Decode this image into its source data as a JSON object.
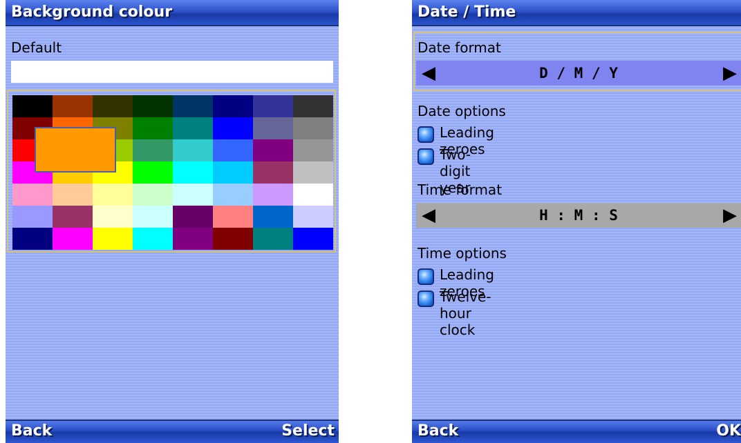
{
  "left_screen": {
    "title": "Background colour",
    "colour_label": "Default",
    "colour_field_value": "",
    "palette": [
      [
        "#000000",
        "#993300",
        "#333300",
        "#003300",
        "#003366",
        "#000080",
        "#333399",
        "#333333"
      ],
      [
        "#800000",
        "#ff6600",
        "#808000",
        "#008000",
        "#008080",
        "#0000ff",
        "#666699",
        "#808080"
      ],
      [
        "#ff0000",
        "#ff9900",
        "#99cc00",
        "#339966",
        "#33cccc",
        "#3366ff",
        "#800080",
        "#969696"
      ],
      [
        "#ff00ff",
        "#ffcc00",
        "#ffff00",
        "#00ff00",
        "#00ffff",
        "#00ccff",
        "#993366",
        "#c0c0c0"
      ],
      [
        "#ff99cc",
        "#ffcc99",
        "#ffff99",
        "#ccffcc",
        "#ccffff",
        "#99ccff",
        "#cc99ff",
        "#ffffff"
      ],
      [
        "#9999ff",
        "#993366",
        "#ffffcc",
        "#ccffff",
        "#660066",
        "#ff8080",
        "#0066cc",
        "#ccccff"
      ],
      [
        "#000080",
        "#ff00ff",
        "#ffff00",
        "#00ffff",
        "#800080",
        "#800000",
        "#008080",
        "#0000ff"
      ]
    ],
    "selected_colour": "#ff9900",
    "softkey_left": "Back",
    "softkey_right": "Select"
  },
  "right_screen": {
    "title": "Date / Time",
    "date_format_label": "Date format",
    "date_format_value": "D / M / Y",
    "date_options_label": "Date options",
    "date_options": [
      {
        "label": "Leading zeroes"
      },
      {
        "label": "Two-digit year"
      }
    ],
    "time_format_label": "Time format",
    "time_format_value": "H : M : S",
    "time_options_label": "Time options",
    "time_options": [
      {
        "label": "Leading zeroes"
      },
      {
        "label": "Twelve-hour clock"
      }
    ],
    "arrow_left": "◀",
    "arrow_right": "▶",
    "softkey_left": "Back",
    "softkey_right": "OK"
  }
}
